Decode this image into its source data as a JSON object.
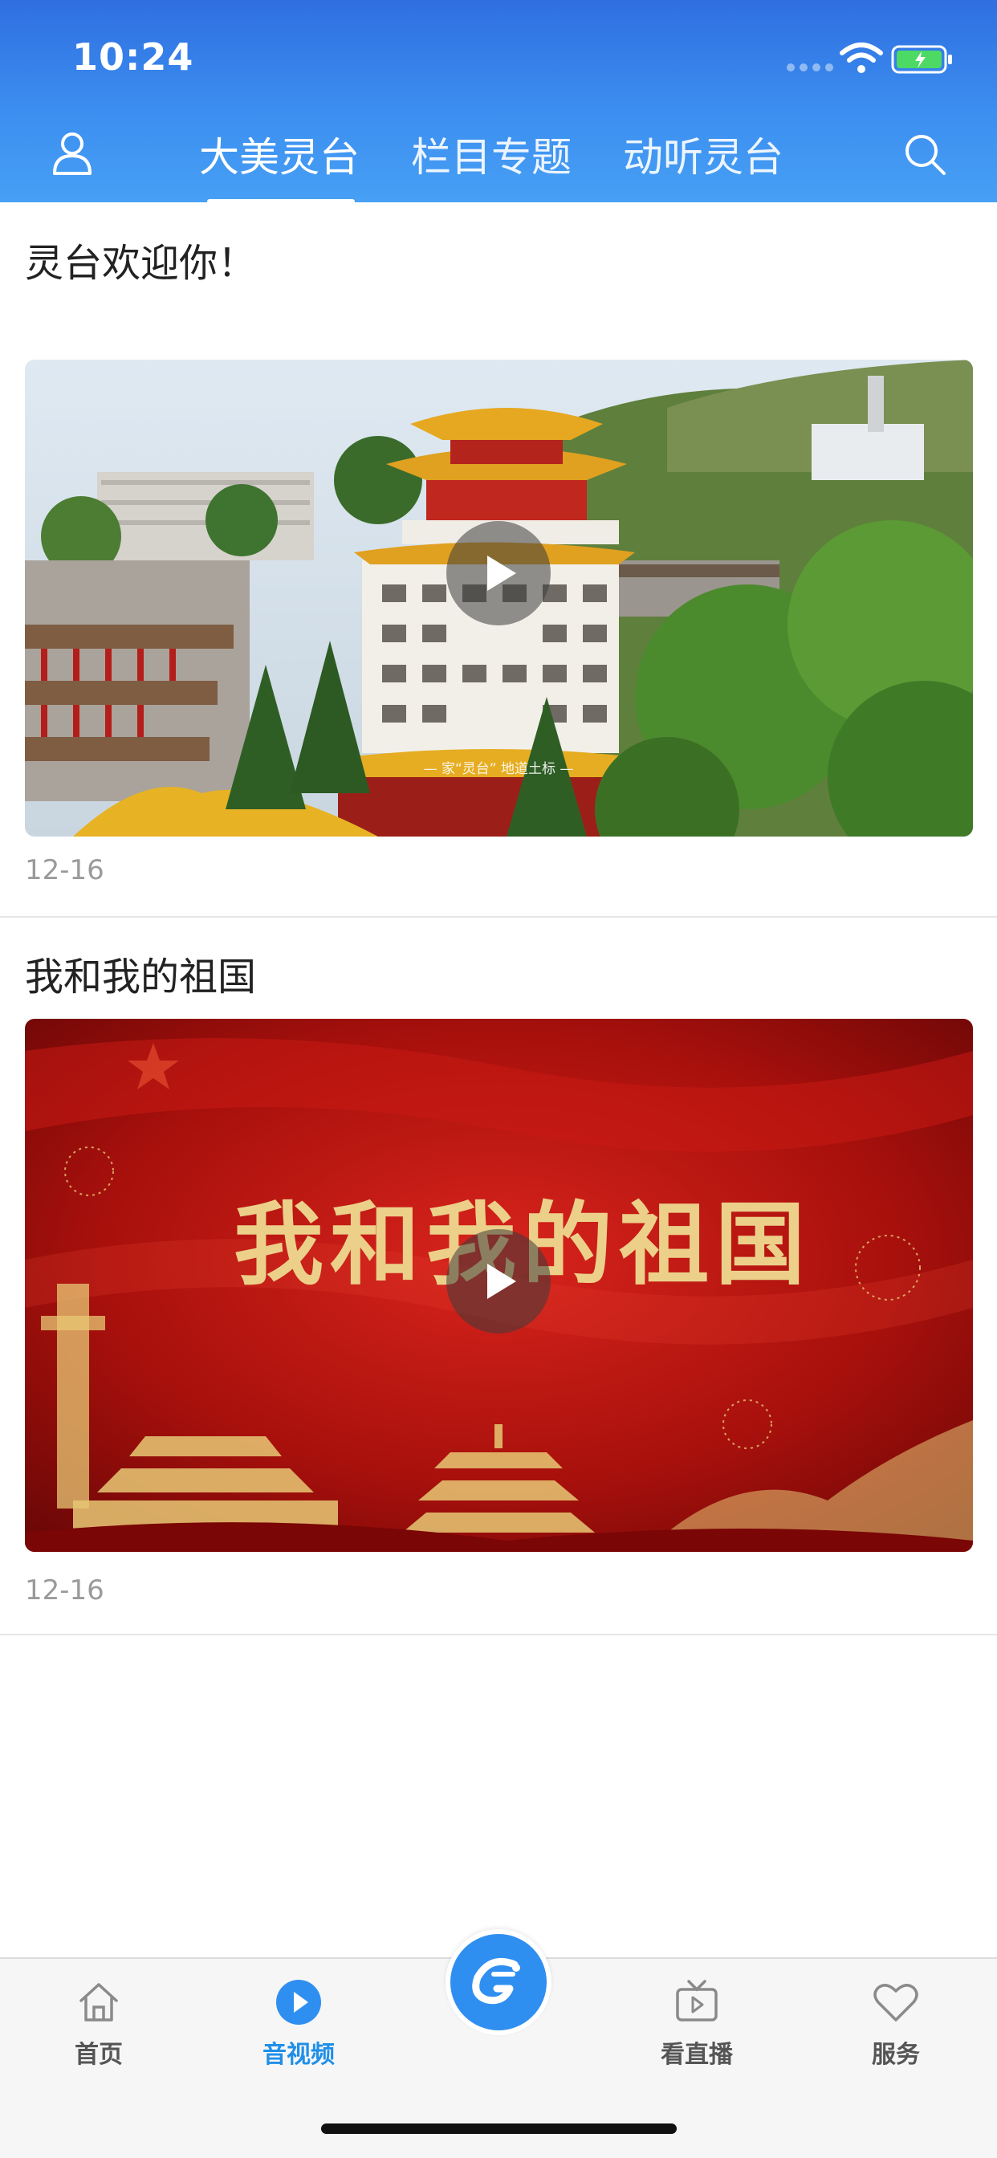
{
  "status_bar": {
    "time": "10:24"
  },
  "header": {
    "tabs": [
      {
        "label": "大美灵台",
        "active": true
      },
      {
        "label": "栏目专题",
        "active": false
      },
      {
        "label": "动听灵台",
        "active": false
      }
    ],
    "icons": {
      "left": "user-icon",
      "right": "search-icon"
    }
  },
  "feed": {
    "items": [
      {
        "title": "灵台欢迎你！",
        "date": "12-16",
        "thumbnail": "aerial video frame of a temple tower with yellow roofs among trees",
        "caption": "— 家“灵台” 地道土标 —"
      },
      {
        "title": "我和我的祖国",
        "date": "12-16",
        "thumbnail": "red banner background with gold calligraphy title",
        "calligraphy": "我和我的祖国"
      }
    ]
  },
  "bottom_nav": {
    "items": [
      {
        "label": "首页",
        "icon": "home-icon",
        "active": false
      },
      {
        "label": "音视频",
        "icon": "play-circle-icon",
        "active": true
      },
      {
        "label": "看直播",
        "icon": "tv-icon",
        "active": false
      },
      {
        "label": "服务",
        "icon": "heart-icon",
        "active": false
      }
    ],
    "center_icon": "app-logo-icon"
  },
  "colors": {
    "header": "#3c8ef0",
    "accent": "#1f8fe8",
    "banner_red": "#b3120f",
    "gold": "#e8c874"
  }
}
